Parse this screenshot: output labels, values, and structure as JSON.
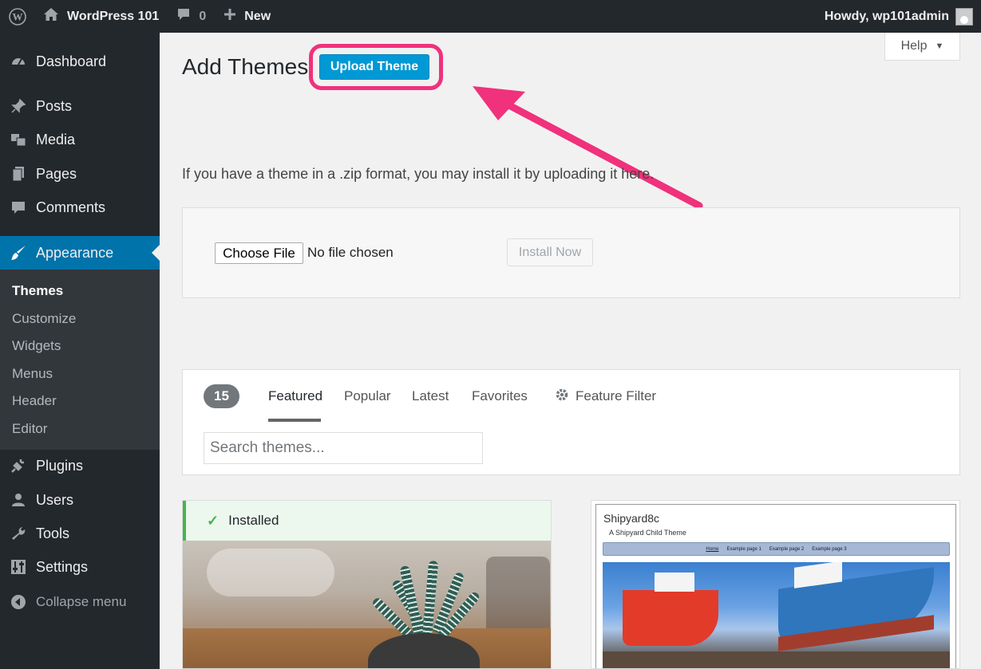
{
  "admin_bar": {
    "site_name": "WordPress 101",
    "comments_count": "0",
    "new_label": "New",
    "greeting": "Howdy, wp101admin"
  },
  "sidebar": {
    "items": [
      {
        "label": "Dashboard",
        "icon": "dashboard-icon"
      },
      {
        "label": "Posts",
        "icon": "pin-icon"
      },
      {
        "label": "Media",
        "icon": "media-icon"
      },
      {
        "label": "Pages",
        "icon": "pages-icon"
      },
      {
        "label": "Comments",
        "icon": "comment-icon"
      },
      {
        "label": "Appearance",
        "icon": "paintbrush-icon"
      },
      {
        "label": "Plugins",
        "icon": "plug-icon"
      },
      {
        "label": "Users",
        "icon": "user-icon"
      },
      {
        "label": "Tools",
        "icon": "wrench-icon"
      },
      {
        "label": "Settings",
        "icon": "settings-sliders-icon"
      }
    ],
    "submenu": [
      "Themes",
      "Customize",
      "Widgets",
      "Menus",
      "Header",
      "Editor"
    ],
    "collapse_label": "Collapse menu"
  },
  "page": {
    "title": "Add Themes",
    "upload_button": "Upload Theme",
    "help_label": "Help",
    "intro": "If you have a theme in a .zip format, you may install it by uploading it here."
  },
  "upload_form": {
    "choose_file": "Choose File",
    "file_status": "No file chosen",
    "install_button": "Install Now"
  },
  "filter": {
    "count": "15",
    "tabs": [
      "Featured",
      "Popular",
      "Latest",
      "Favorites"
    ],
    "feature_filter": "Feature Filter",
    "search_placeholder": "Search themes..."
  },
  "themes": {
    "installed_label": "Installed",
    "shipyard": {
      "title": "Shipyard8c",
      "tagline": "A Shipyard Child Theme",
      "nav": [
        "Home",
        "Example page 1",
        "Example page 2",
        "Example page 3"
      ]
    }
  },
  "colors": {
    "admin_bar": "#23282d",
    "accent": "#0073aa",
    "upload_button": "#0099d5",
    "annotation": "#f0317b",
    "installed": "#46b450"
  }
}
